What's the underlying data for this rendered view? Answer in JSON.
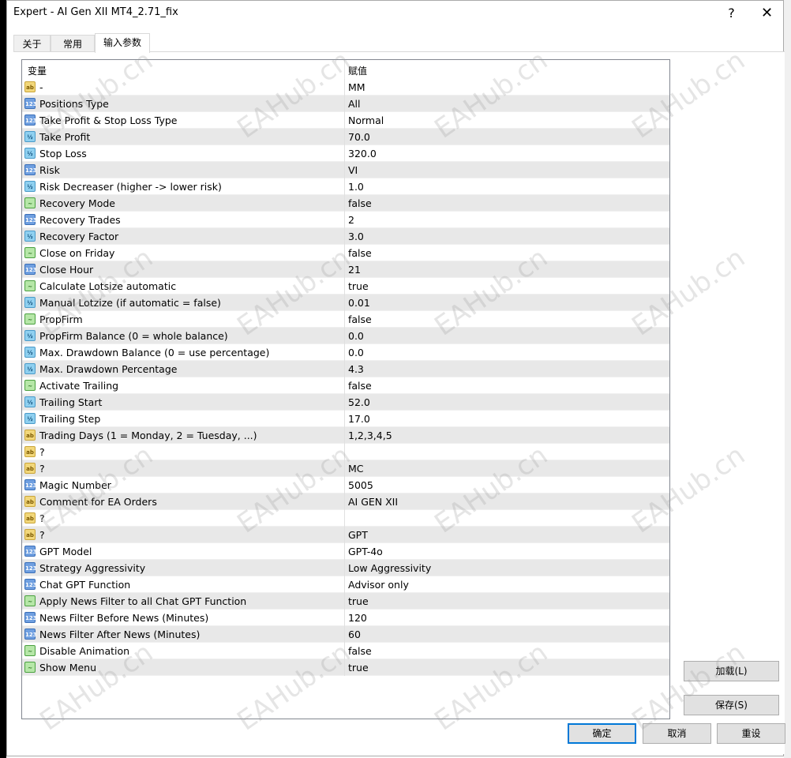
{
  "window": {
    "title": "Expert - AI Gen XII MT4_2.71_fix",
    "help_glyph": "?",
    "close_glyph": "✕"
  },
  "tabs": [
    {
      "label": "关于",
      "active": false
    },
    {
      "label": "常用",
      "active": false
    },
    {
      "label": "输入参数",
      "active": true
    }
  ],
  "table": {
    "headers": {
      "variable": "变量",
      "value": "赋值"
    },
    "rows": [
      {
        "icon": "ab",
        "name": "-",
        "value": " MM"
      },
      {
        "icon": "123",
        "name": "Positions Type",
        "value": "All"
      },
      {
        "icon": "123",
        "name": "Take Profit & Stop Loss Type",
        "value": "Normal"
      },
      {
        "icon": "half",
        "name": "Take Profit",
        "value": "70.0"
      },
      {
        "icon": "half",
        "name": "Stop Loss",
        "value": "320.0"
      },
      {
        "icon": "123",
        "name": "Risk",
        "value": "VI"
      },
      {
        "icon": "half",
        "name": "Risk Decreaser (higher -> lower risk)",
        "value": "1.0"
      },
      {
        "icon": "bool",
        "name": "Recovery Mode",
        "value": "false"
      },
      {
        "icon": "123",
        "name": "Recovery Trades",
        "value": "2"
      },
      {
        "icon": "half",
        "name": "Recovery Factor",
        "value": "3.0"
      },
      {
        "icon": "bool",
        "name": "Close on Friday",
        "value": "false"
      },
      {
        "icon": "123",
        "name": "Close Hour",
        "value": "21"
      },
      {
        "icon": "bool",
        "name": "Calculate Lotsize automatic",
        "value": "true"
      },
      {
        "icon": "half",
        "name": "Manual Lotzize (if automatic = false)",
        "value": "0.01"
      },
      {
        "icon": "bool",
        "name": "PropFirm",
        "value": "false"
      },
      {
        "icon": "half",
        "name": "PropFirm Balance (0 = whole balance)",
        "value": "0.0"
      },
      {
        "icon": "half",
        "name": "Max. Drawdown Balance (0 = use percentage)",
        "value": "0.0"
      },
      {
        "icon": "half",
        "name": "Max. Drawdown Percentage",
        "value": "4.3"
      },
      {
        "icon": "bool",
        "name": "Activate Trailing",
        "value": "false"
      },
      {
        "icon": "half",
        "name": "Trailing Start",
        "value": "52.0"
      },
      {
        "icon": "half",
        "name": "Trailing Step",
        "value": "17.0"
      },
      {
        "icon": "ab",
        "name": "Trading Days (1 = Monday, 2 = Tuesday, ...)",
        "value": "1,2,3,4,5"
      },
      {
        "icon": "ab",
        "name": "?",
        "value": ""
      },
      {
        "icon": "ab",
        "name": "?",
        "value": " MC"
      },
      {
        "icon": "123",
        "name": "Magic Number",
        "value": "5005"
      },
      {
        "icon": "ab",
        "name": "Comment for EA Orders",
        "value": "AI GEN XII"
      },
      {
        "icon": "ab",
        "name": "?",
        "value": ""
      },
      {
        "icon": "ab",
        "name": "?",
        "value": " GPT"
      },
      {
        "icon": "123",
        "name": "GPT Model",
        "value": "GPT-4o"
      },
      {
        "icon": "123",
        "name": "Strategy Aggressivity",
        "value": "Low Aggressivity"
      },
      {
        "icon": "123",
        "name": "Chat GPT Function",
        "value": "Advisor only"
      },
      {
        "icon": "bool",
        "name": "Apply News Filter to all Chat GPT Function",
        "value": "true"
      },
      {
        "icon": "123",
        "name": "News Filter Before News (Minutes)",
        "value": "120"
      },
      {
        "icon": "123",
        "name": "News Filter After News (Minutes)",
        "value": "60"
      },
      {
        "icon": "bool",
        "name": "Disable Animation",
        "value": "false"
      },
      {
        "icon": "bool",
        "name": "Show Menu",
        "value": "true"
      }
    ]
  },
  "buttons": {
    "load": "加载(L)",
    "save": "保存(S)",
    "ok": "确定",
    "cancel": "取消",
    "reset": "重设"
  },
  "watermark": "EAHub.cn"
}
